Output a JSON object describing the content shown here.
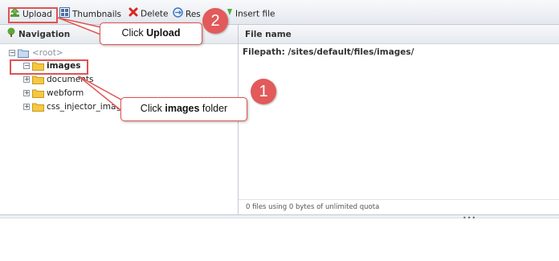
{
  "toolbar": {
    "upload": {
      "label": "Upload",
      "icon": "upload-icon"
    },
    "thumbnails": {
      "label": "Thumbnails",
      "icon": "thumbnails-icon"
    },
    "delete": {
      "label": "Delete",
      "icon": "delete-icon"
    },
    "resize": {
      "label": "Res",
      "icon": "resize-icon"
    },
    "insert": {
      "label": "Insert file",
      "icon": "insert-icon"
    }
  },
  "navigation": {
    "title": "Navigation",
    "tree": [
      {
        "label": "<root>",
        "toggle": "−",
        "expanded": true
      },
      {
        "label": "images",
        "toggle": "−",
        "selected": true
      },
      {
        "label": "documents",
        "toggle": "+"
      },
      {
        "label": "webform",
        "toggle": "+"
      },
      {
        "label": "css_injector_imag",
        "toggle": "+"
      }
    ]
  },
  "file_panel": {
    "column_header": "File name",
    "filepath": "Filepath: /sites/default/files/images/",
    "status": "0 files using 0 bytes of unlimited quota",
    "splitter_grip": "•••",
    "side_grip": "•"
  },
  "annotations": {
    "step1": {
      "number": "1",
      "text_prefix": "Click ",
      "text_bold": "images",
      "text_suffix": " folder"
    },
    "step2": {
      "number": "2",
      "text_prefix": "Click ",
      "text_bold": "Upload"
    }
  },
  "colors": {
    "annotation_red": "#e05353",
    "folder_yellow": "#f5c842",
    "toolbar_bg": "#e4e8ee"
  }
}
